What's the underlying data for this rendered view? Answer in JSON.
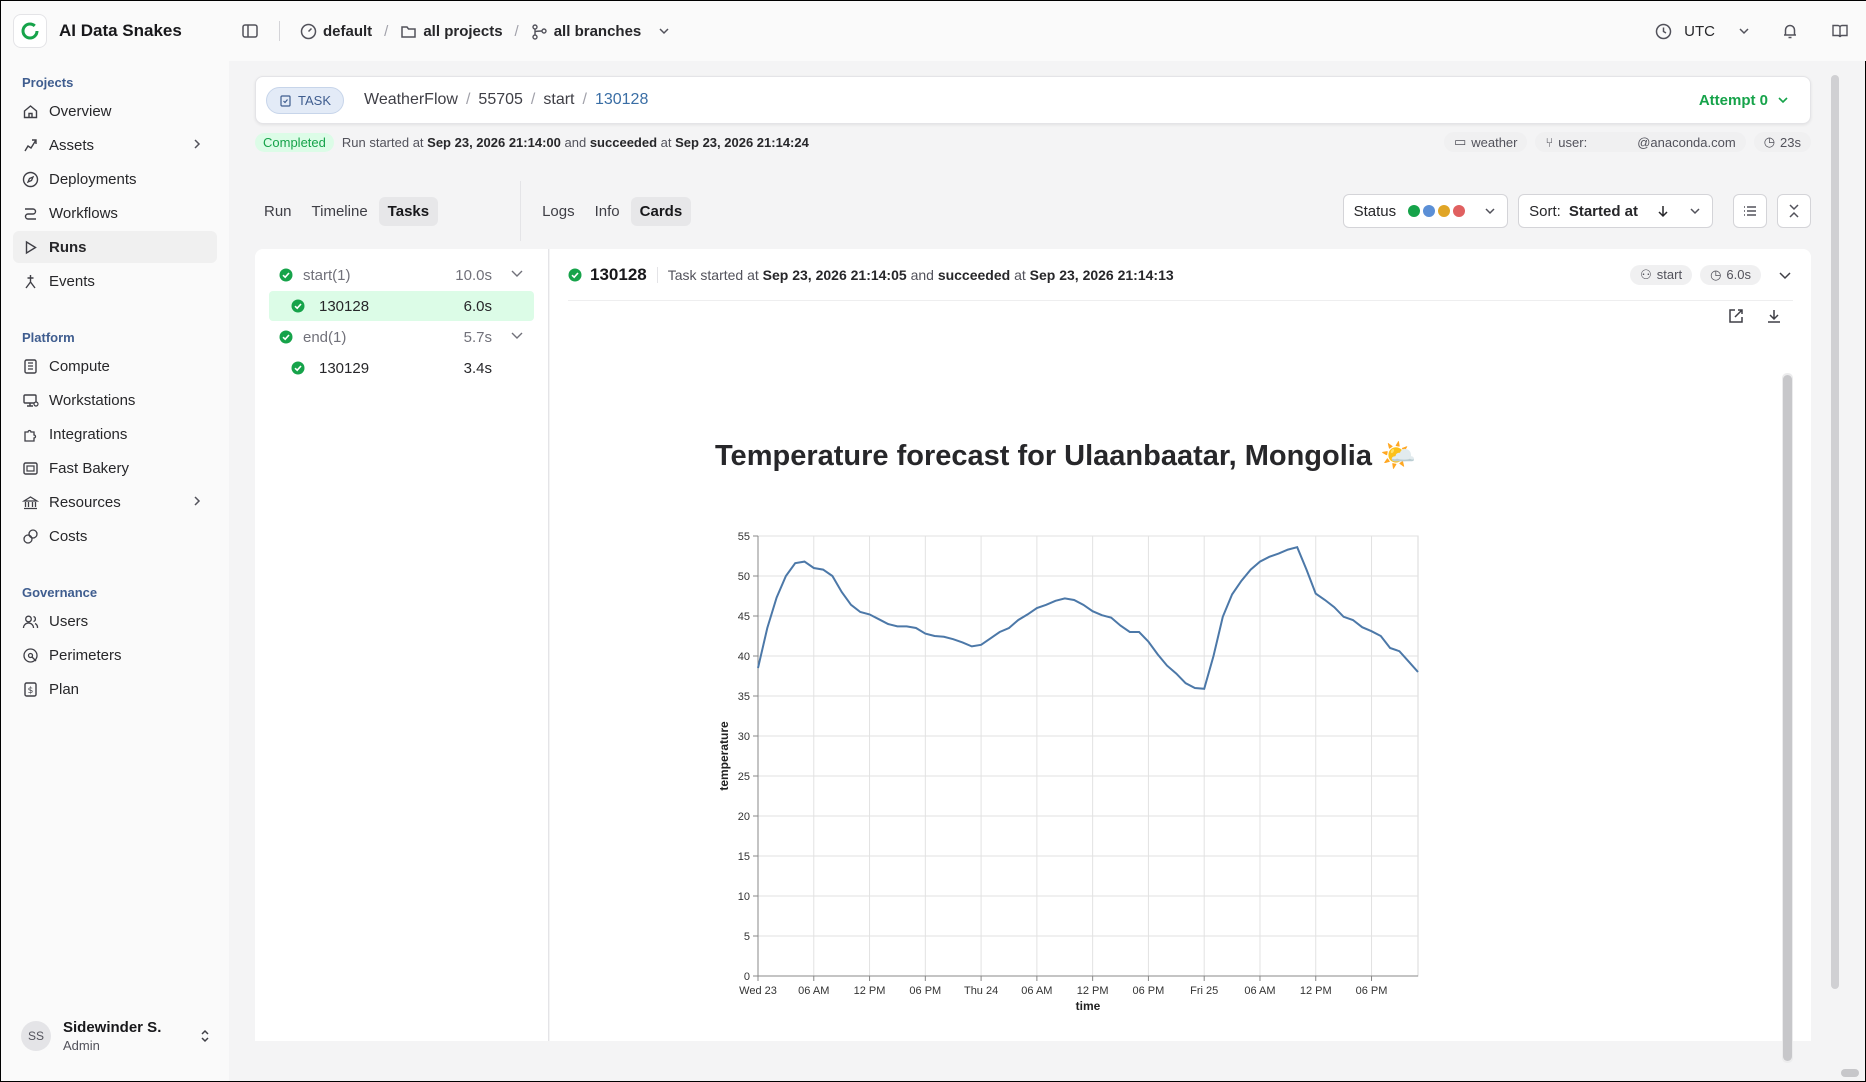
{
  "header": {
    "app_name": "AI Data Snakes",
    "workspace": "default",
    "projects": "all projects",
    "branches": "all branches",
    "timezone": "UTC"
  },
  "sidebar": {
    "sections": [
      {
        "label": "Projects",
        "items": [
          {
            "label": "Overview",
            "icon": "home-icon"
          },
          {
            "label": "Assets",
            "icon": "assets-icon",
            "chevron": true
          },
          {
            "label": "Deployments",
            "icon": "compass-icon"
          },
          {
            "label": "Workflows",
            "icon": "workflow-icon"
          },
          {
            "label": "Runs",
            "icon": "play-icon",
            "active": true
          },
          {
            "label": "Events",
            "icon": "events-icon"
          }
        ]
      },
      {
        "label": "Platform",
        "items": [
          {
            "label": "Compute",
            "icon": "compute-icon"
          },
          {
            "label": "Workstations",
            "icon": "workstation-icon"
          },
          {
            "label": "Integrations",
            "icon": "puzzle-icon"
          },
          {
            "label": "Fast Bakery",
            "icon": "bakery-icon"
          },
          {
            "label": "Resources",
            "icon": "resources-icon",
            "chevron": true
          },
          {
            "label": "Costs",
            "icon": "coins-icon"
          }
        ]
      },
      {
        "label": "Governance",
        "items": [
          {
            "label": "Users",
            "icon": "users-icon"
          },
          {
            "label": "Perimeters",
            "icon": "perimeter-icon"
          },
          {
            "label": "Plan",
            "icon": "plan-icon"
          }
        ]
      }
    ],
    "user": {
      "initials": "SS",
      "name": "Sidewinder S.",
      "role": "Admin"
    }
  },
  "task_header": {
    "badge": "TASK",
    "crumbs": [
      "WeatherFlow",
      "55705",
      "start",
      "130128"
    ],
    "attempt": "Attempt 0"
  },
  "run_line": {
    "status": "Completed",
    "text1": "Run started at",
    "started": "Sep 23, 2026 21:14:00",
    "text2": "and",
    "succeeded_word": "succeeded",
    "text3": "at",
    "ended": "Sep 23, 2026 21:14:24",
    "chips": [
      "weather",
      "user:",
      "@anaconda.com",
      "23s"
    ]
  },
  "tabs": {
    "left": [
      "Run",
      "Timeline",
      "Tasks"
    ],
    "right": [
      "Logs",
      "Info",
      "Cards"
    ],
    "status_label": "Status",
    "sort_label": "Sort:",
    "sort_value": "Started at"
  },
  "task_list": [
    {
      "name": "start(1)",
      "duration": "10.0s",
      "children": [
        {
          "id": "130128",
          "duration": "6.0s",
          "selected": true
        }
      ]
    },
    {
      "name": "end(1)",
      "duration": "5.7s",
      "children": [
        {
          "id": "130129",
          "duration": "3.4s"
        }
      ]
    }
  ],
  "detail": {
    "id": "130128",
    "text1": "Task started at",
    "started": "Sep 23, 2026 21:14:05",
    "text2": "and",
    "succeeded_word": "succeeded",
    "text3": "at",
    "ended": "Sep 23, 2026 21:14:13",
    "step_chip": "start",
    "duration_chip": "6.0s"
  },
  "colors": {
    "success": "#16a34a",
    "accent": "#3a6ea5",
    "line": "#4c78a8"
  },
  "chart_data": {
    "type": "line",
    "title": "Temperature forecast for Ulaanbaatar, Mongolia 🌤️",
    "xlabel": "time",
    "ylabel": "temperature",
    "ylim": [
      0,
      55
    ],
    "yticks": [
      0,
      5,
      10,
      15,
      20,
      25,
      30,
      35,
      40,
      45,
      50,
      55
    ],
    "xticks": [
      {
        "label": "Wed 23",
        "h": 0
      },
      {
        "label": "06 AM",
        "h": 6
      },
      {
        "label": "12 PM",
        "h": 12
      },
      {
        "label": "06 PM",
        "h": 18
      },
      {
        "label": "Thu 24",
        "h": 24
      },
      {
        "label": "06 AM",
        "h": 30
      },
      {
        "label": "12 PM",
        "h": 36
      },
      {
        "label": "06 PM",
        "h": 42
      },
      {
        "label": "Fri 25",
        "h": 48
      },
      {
        "label": "06 AM",
        "h": 54
      },
      {
        "label": "12 PM",
        "h": 60
      },
      {
        "label": "06 PM",
        "h": 66
      }
    ],
    "xlim_hours": [
      0,
      71
    ],
    "series": [
      {
        "points": [
          [
            0,
            38.5
          ],
          [
            1,
            43.5
          ],
          [
            2,
            47.3
          ],
          [
            3,
            50.0
          ],
          [
            4,
            51.6
          ],
          [
            5,
            51.8
          ],
          [
            6,
            51.0
          ],
          [
            7,
            50.8
          ],
          [
            8,
            50.0
          ],
          [
            9,
            48.0
          ],
          [
            10,
            46.4
          ],
          [
            11,
            45.5
          ],
          [
            12,
            45.2
          ],
          [
            13,
            44.6
          ],
          [
            14,
            44.0
          ],
          [
            15,
            43.7
          ],
          [
            16,
            43.7
          ],
          [
            17,
            43.5
          ],
          [
            18,
            42.8
          ],
          [
            19,
            42.5
          ],
          [
            20,
            42.4
          ],
          [
            21,
            42.1
          ],
          [
            22,
            41.7
          ],
          [
            23,
            41.2
          ],
          [
            24,
            41.4
          ],
          [
            25,
            42.2
          ],
          [
            26,
            43.0
          ],
          [
            27,
            43.5
          ],
          [
            28,
            44.5
          ],
          [
            29,
            45.2
          ],
          [
            30,
            46.0
          ],
          [
            31,
            46.4
          ],
          [
            32,
            46.9
          ],
          [
            33,
            47.2
          ],
          [
            34,
            47.0
          ],
          [
            35,
            46.4
          ],
          [
            36,
            45.6
          ],
          [
            37,
            45.1
          ],
          [
            38,
            44.8
          ],
          [
            39,
            43.8
          ],
          [
            40,
            43.0
          ],
          [
            41,
            43.0
          ],
          [
            42,
            41.8
          ],
          [
            43,
            40.2
          ],
          [
            44,
            38.8
          ],
          [
            45,
            37.8
          ],
          [
            46,
            36.6
          ],
          [
            47,
            36.0
          ],
          [
            48,
            35.9
          ],
          [
            49,
            40.0
          ],
          [
            50,
            44.9
          ],
          [
            51,
            47.7
          ],
          [
            52,
            49.4
          ],
          [
            53,
            50.8
          ],
          [
            54,
            51.8
          ],
          [
            55,
            52.4
          ],
          [
            56,
            52.8
          ],
          [
            57,
            53.3
          ],
          [
            58,
            53.6
          ],
          [
            59,
            50.8
          ],
          [
            60,
            47.8
          ],
          [
            61,
            47.0
          ],
          [
            62,
            46.1
          ],
          [
            63,
            44.9
          ],
          [
            64,
            44.5
          ],
          [
            65,
            43.6
          ],
          [
            66,
            43.1
          ],
          [
            67,
            42.5
          ],
          [
            68,
            41.0
          ],
          [
            69,
            40.6
          ],
          [
            70,
            39.3
          ],
          [
            71,
            38.0
          ]
        ]
      }
    ],
    "grid": true
  }
}
